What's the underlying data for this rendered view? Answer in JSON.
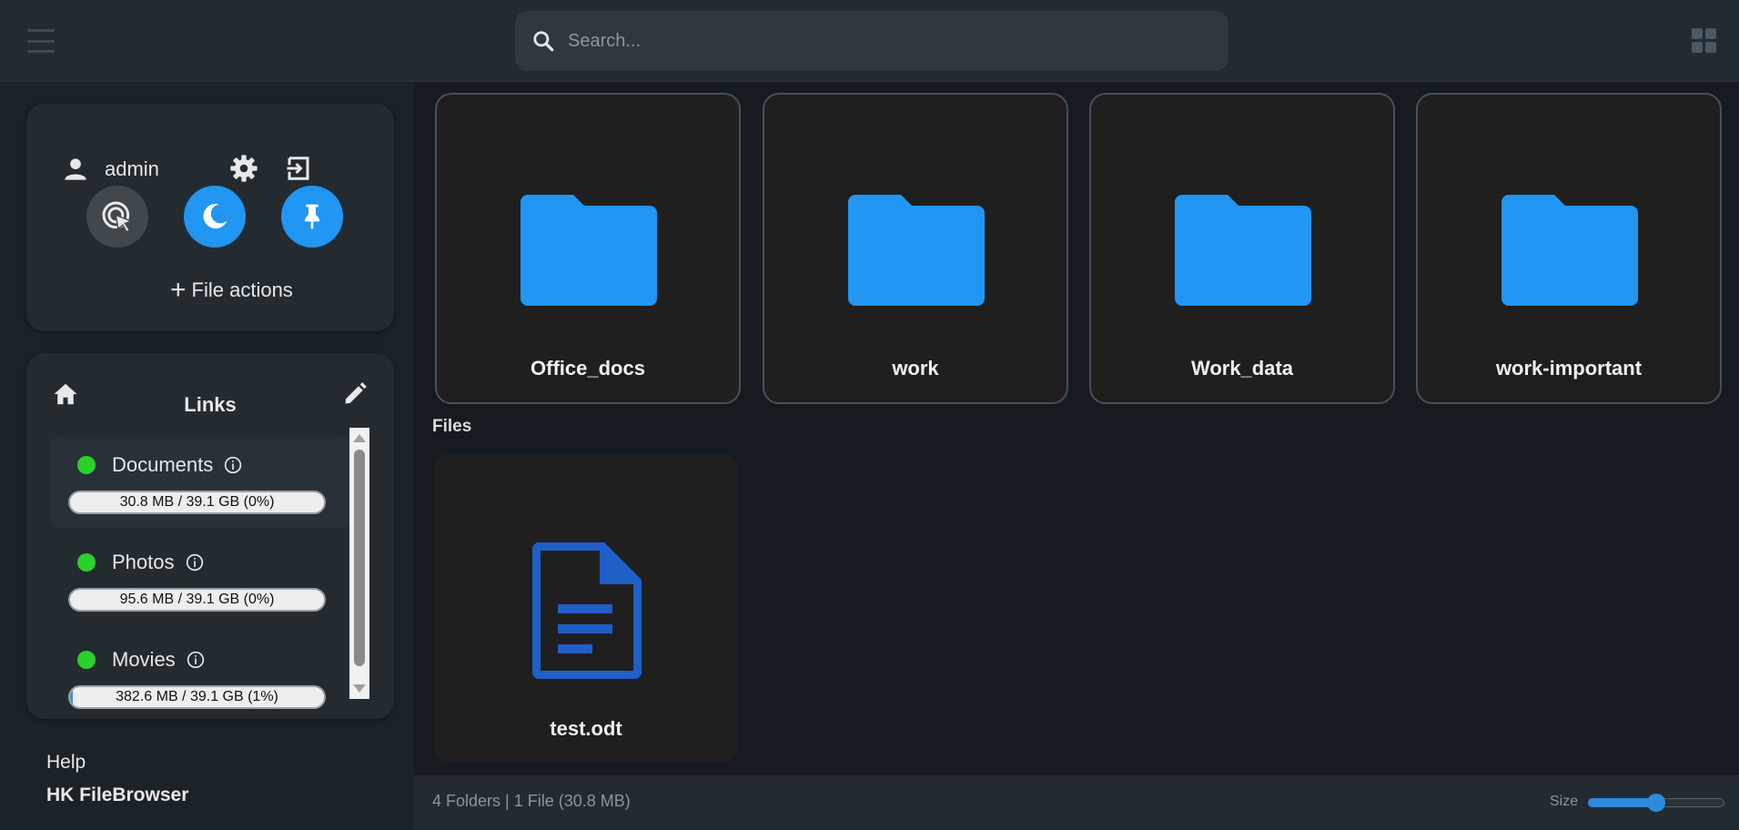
{
  "header": {
    "search_placeholder": "Search..."
  },
  "sidebar": {
    "user": {
      "name": "admin"
    },
    "file_actions_label": "File actions",
    "links": {
      "title": "Links",
      "items": [
        {
          "label": "Documents",
          "usage": "30.8 MB / 39.1 GB (0%)",
          "fraction": 0.0
        },
        {
          "label": "Photos",
          "usage": "95.6 MB / 39.1 GB (0%)",
          "fraction": 0.0
        },
        {
          "label": "Movies",
          "usage": "382.6 MB / 39.1 GB (1%)",
          "fraction": 0.01
        }
      ]
    },
    "help_label": "Help",
    "brand_label": "HK FileBrowser"
  },
  "main": {
    "folders": [
      {
        "name": "Office_docs"
      },
      {
        "name": "work"
      },
      {
        "name": "Work_data"
      },
      {
        "name": "work-important"
      }
    ],
    "files_label": "Files",
    "files": [
      {
        "name": "test.odt"
      }
    ]
  },
  "statusbar": {
    "summary": "4 Folders | 1 File (30.8 MB)",
    "size_label": "Size",
    "size_fraction": 0.5
  },
  "colors": {
    "accent": "#2196f3",
    "status_green": "#2ad12a",
    "file_icon": "#1e5fc8"
  }
}
